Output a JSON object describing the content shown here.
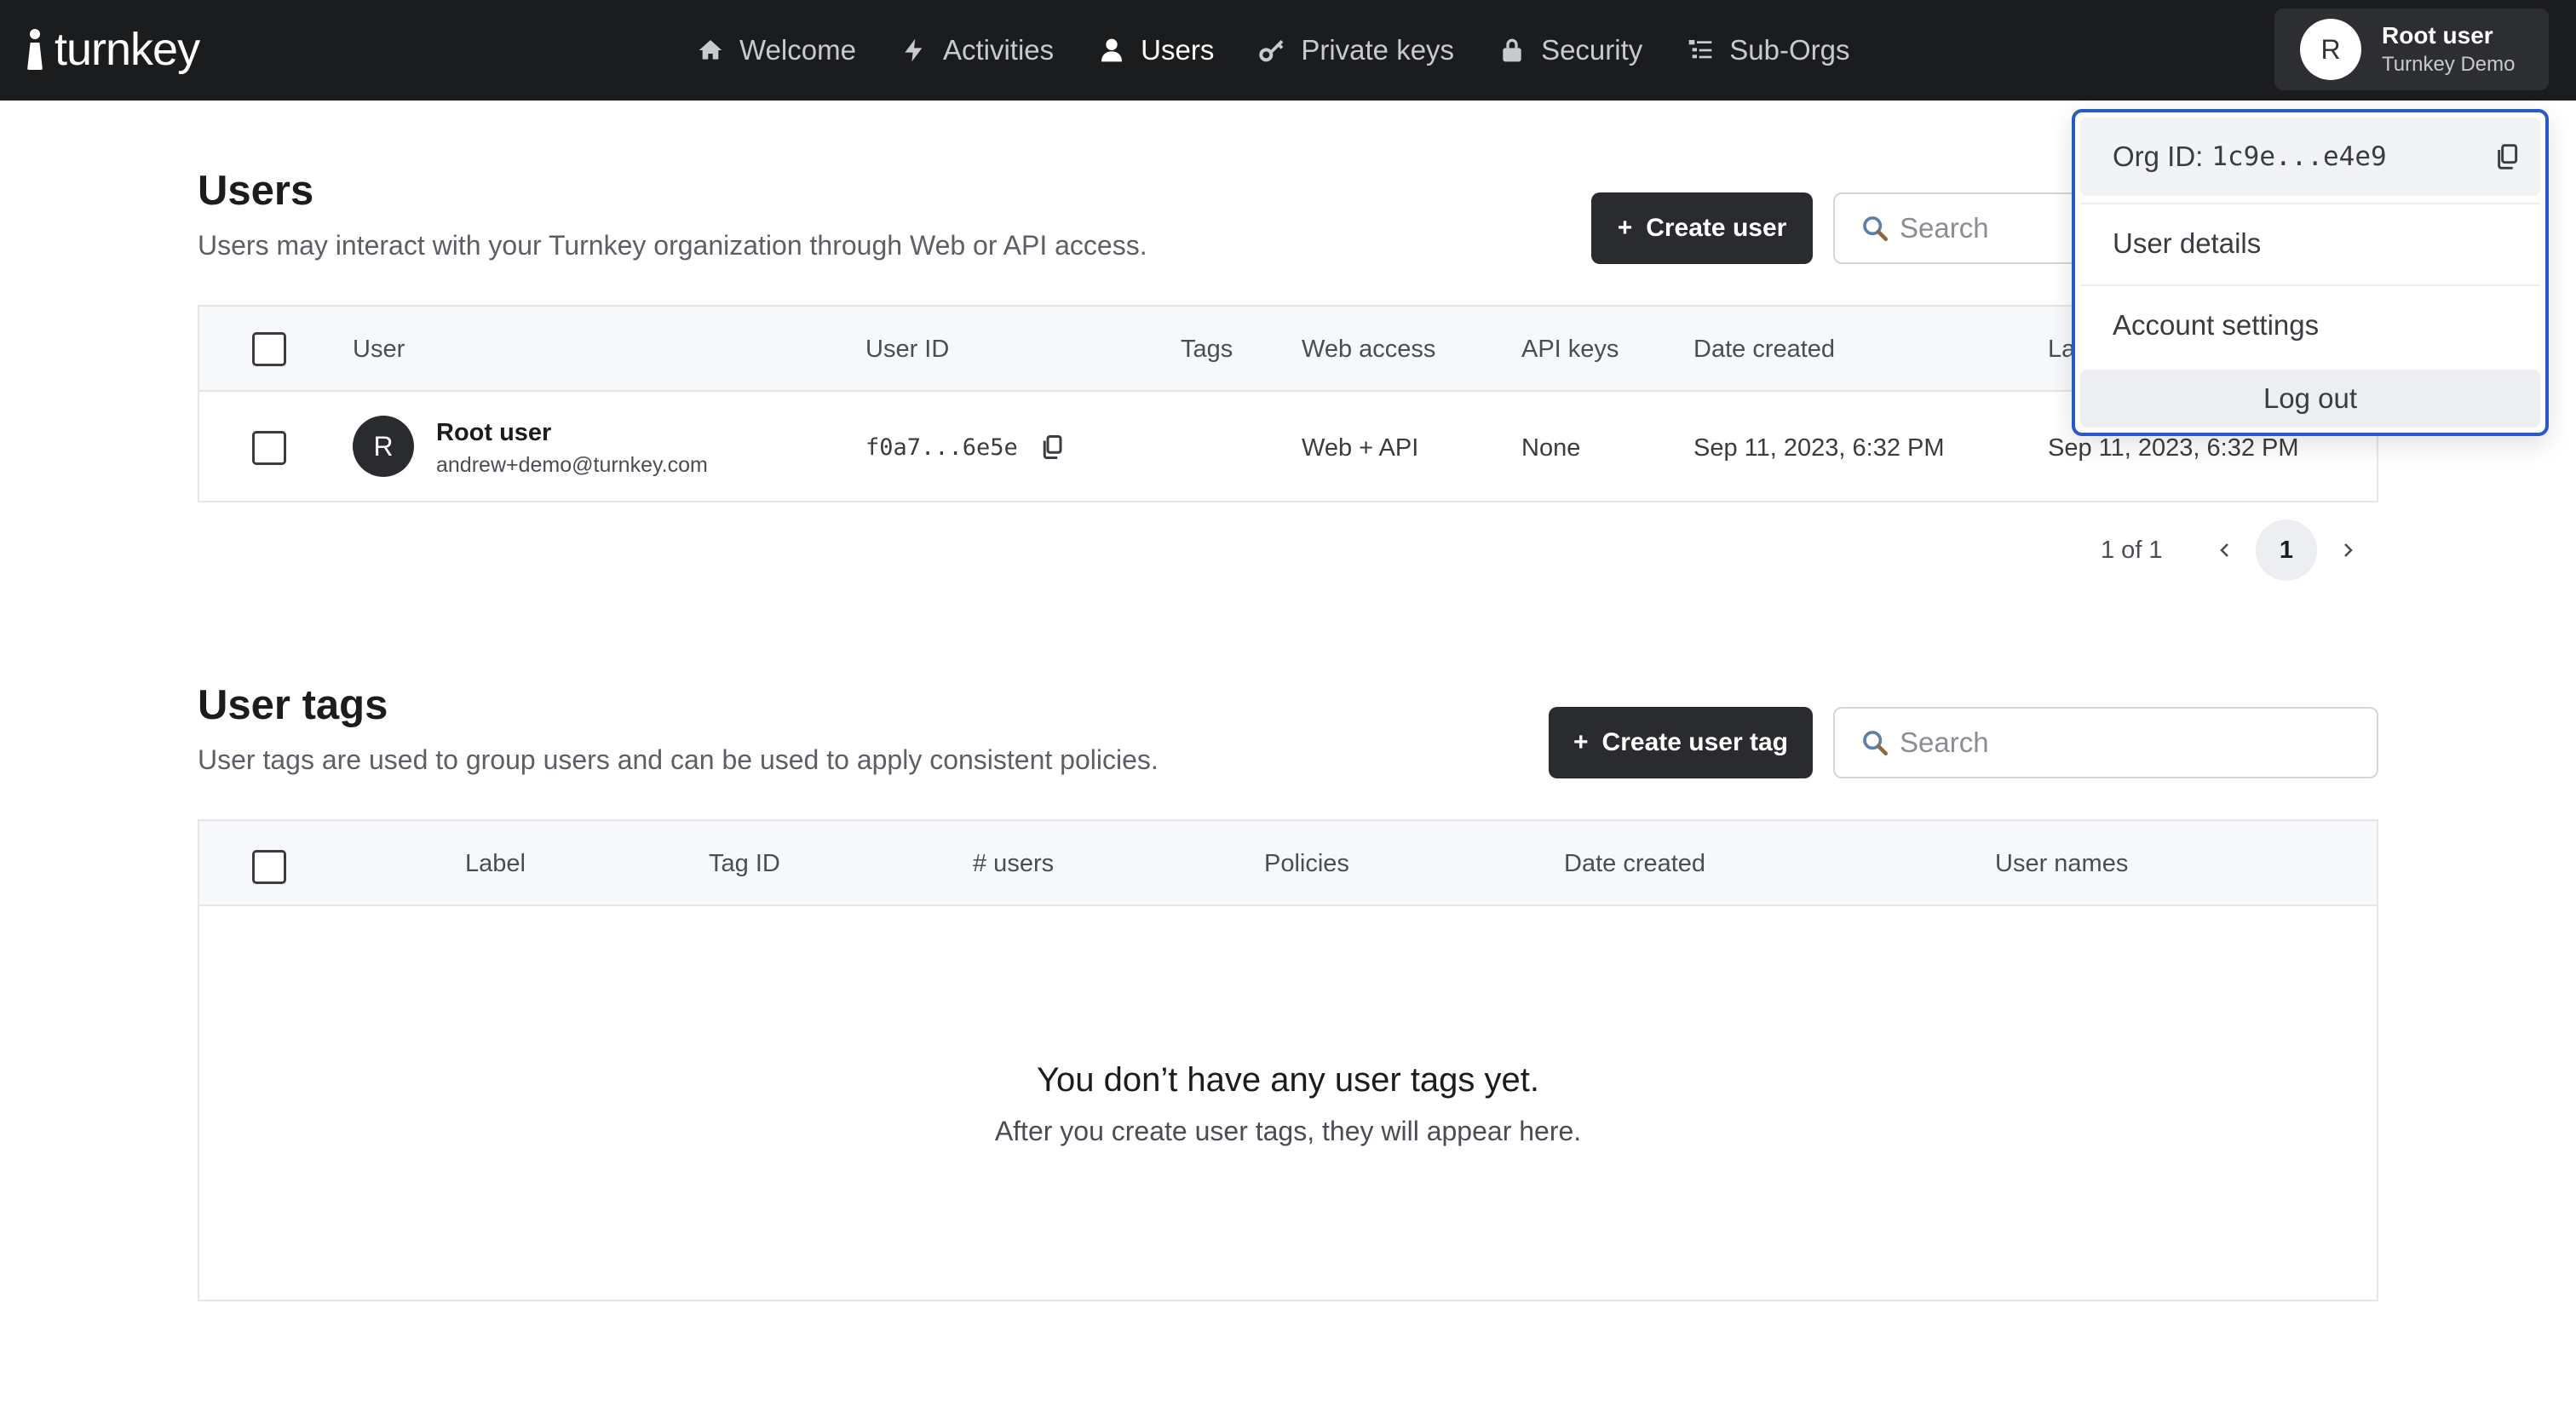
{
  "brand": {
    "name": "turnkey"
  },
  "nav": {
    "items": [
      {
        "label": "Welcome",
        "icon": "home-icon"
      },
      {
        "label": "Activities",
        "icon": "bolt-icon"
      },
      {
        "label": "Users",
        "icon": "user-icon",
        "active": true
      },
      {
        "label": "Private keys",
        "icon": "key-icon"
      },
      {
        "label": "Security",
        "icon": "lock-icon"
      },
      {
        "label": "Sub-Orgs",
        "icon": "list-icon"
      }
    ]
  },
  "account": {
    "avatar_initial": "R",
    "name": "Root user",
    "org": "Turnkey Demo"
  },
  "dropdown": {
    "org_label": "Org ID:",
    "org_id": "1c9e...e4e9",
    "user_details": "User details",
    "account_settings": "Account settings",
    "logout": "Log out"
  },
  "users": {
    "title": "Users",
    "subtitle": "Users may interact with your Turnkey organization through Web or API access.",
    "create_button": "Create user",
    "search_placeholder": "Search",
    "columns": [
      "User",
      "User ID",
      "Tags",
      "Web access",
      "API keys",
      "Date created",
      "Last updated"
    ],
    "rows": [
      {
        "avatar_initial": "R",
        "name": "Root user",
        "email": "andrew+demo@turnkey.com",
        "user_id": "f0a7...6e5e",
        "tags": "",
        "web_access": "Web + API",
        "api_keys": "None",
        "date_created": "Sep 11, 2023, 6:32 PM",
        "last_updated": "Sep 11, 2023, 6:32 PM"
      }
    ],
    "pagination": {
      "text": "1 of 1",
      "current_page": "1"
    }
  },
  "user_tags": {
    "title": "User tags",
    "subtitle": "User tags are used to group users and can be used to apply consistent policies.",
    "create_button": "Create user tag",
    "search_placeholder": "Search",
    "columns": [
      "Label",
      "Tag ID",
      "# users",
      "Policies",
      "Date created",
      "User names"
    ],
    "empty_title": "You don’t have any user tags yet.",
    "empty_subtitle": "After you create user tags, they will appear here."
  },
  "colors": {
    "nav_bg": "#1b1c1e",
    "button_dark": "#2a2b2e",
    "dropdown_border": "#2759c9"
  }
}
